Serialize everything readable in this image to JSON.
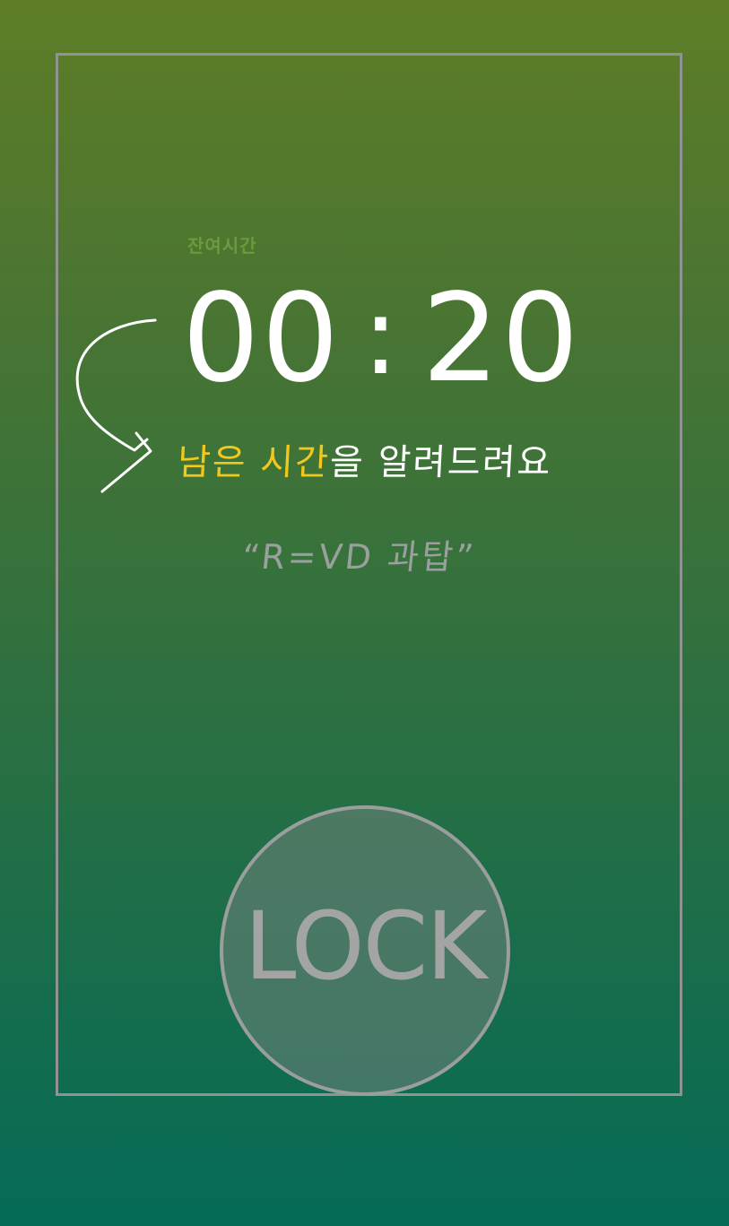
{
  "remaining": {
    "label": "잔여시간",
    "minutes": "00",
    "separator": ":",
    "seconds": "20"
  },
  "message": {
    "highlight": "남은 시간",
    "rest": "을 알려드려요"
  },
  "quote": "“R=VD 과탑”",
  "lock_button": {
    "label": "LOCK"
  },
  "colors": {
    "gradient_top": "#5e7d26",
    "gradient_bottom": "#056b57",
    "highlight": "#f2c81c",
    "frame": "#8f9492",
    "button_text": "#a3a5a4"
  }
}
